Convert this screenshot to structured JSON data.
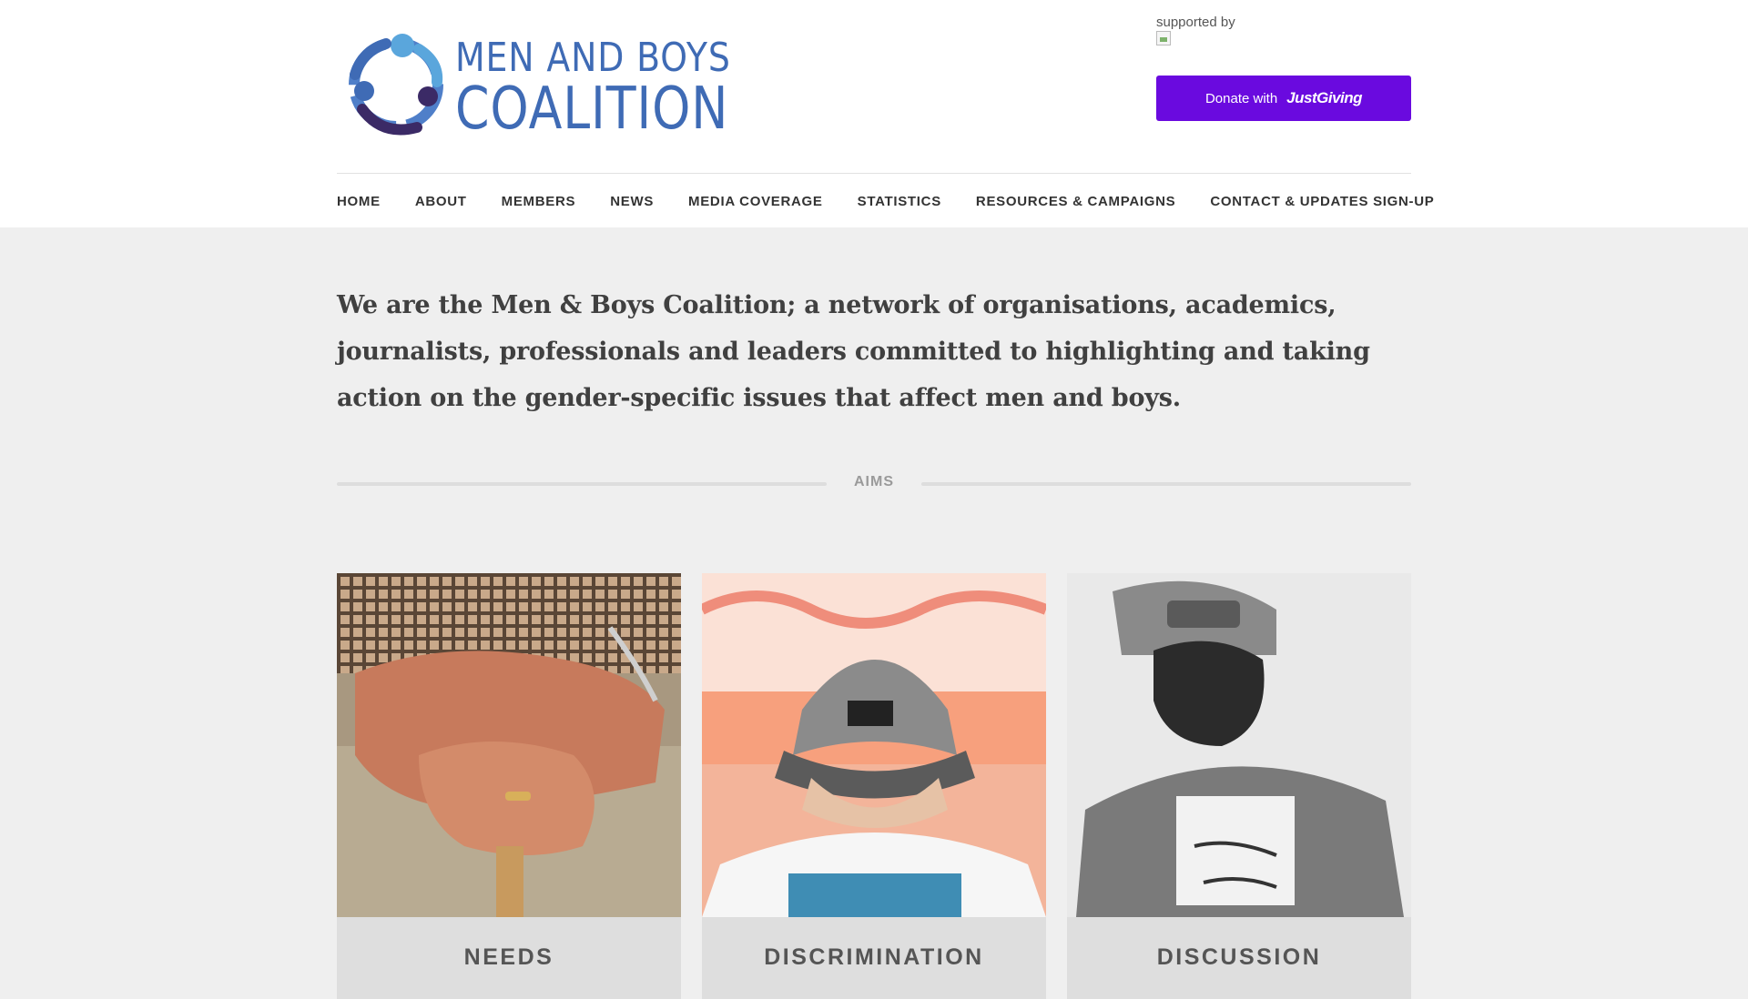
{
  "header": {
    "logo": {
      "line1": "MEN AND BOYS",
      "line2": "COALITION",
      "icon": "people-circle-logo-icon",
      "colors": {
        "blue": "#3f6bb5",
        "light_blue": "#5aa6dc",
        "purple": "#3b2a66"
      }
    },
    "supported_by": "supported by",
    "donate": {
      "label": "Donate with",
      "brand": "JustGiving",
      "color": "#6a0adf"
    }
  },
  "nav": {
    "items": [
      {
        "label": "HOME"
      },
      {
        "label": "ABOUT"
      },
      {
        "label": "MEMBERS"
      },
      {
        "label": "NEWS"
      },
      {
        "label": "MEDIA COVERAGE"
      },
      {
        "label": "STATISTICS"
      },
      {
        "label": "RESOURCES & CAMPAIGNS"
      },
      {
        "label": "CONTACT & UPDATES SIGN-UP"
      }
    ]
  },
  "intro": {
    "text": "We are the Men & Boys Coalition; a network of organisations, academics, journalists, professionals and leaders committed to highlighting and taking action on the gender-specific issues that affect men and boys."
  },
  "aims": {
    "label": "AIMS"
  },
  "cards": [
    {
      "title": "NEEDS",
      "image": "elderly-hands-on-cane-photo"
    },
    {
      "title": "DISCRIMINATION",
      "image": "man-in-cap-looking-down-photo"
    },
    {
      "title": "DISCUSSION",
      "image": "smiling-boy-thank-you-tshirt-photo"
    }
  ]
}
